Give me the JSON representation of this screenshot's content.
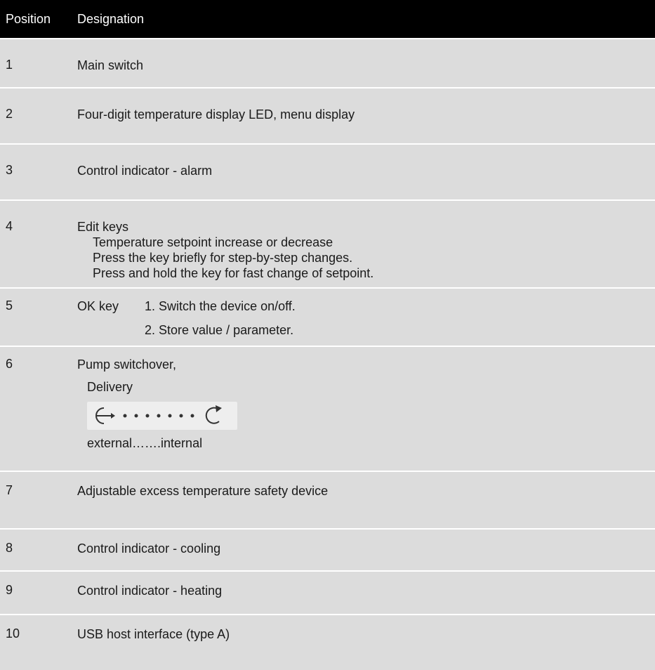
{
  "table": {
    "header": {
      "position": "Position",
      "designation": "Designation"
    },
    "rows": [
      {
        "position": "1",
        "designation": "Main switch"
      },
      {
        "position": "2",
        "designation": "Four-digit temperature display LED, menu display"
      },
      {
        "position": "3",
        "designation": "Control indicator - alarm"
      },
      {
        "position": "4",
        "designation": "Edit keys",
        "details": [
          "Temperature setpoint increase or decrease",
          "Press the key briefly for step-by-step changes.",
          "Press and hold the key for fast change of setpoint."
        ]
      },
      {
        "position": "5",
        "designation": "OK key",
        "steps": [
          "1. Switch the device on/off.",
          "2. Store value / parameter."
        ]
      },
      {
        "position": "6",
        "designation": "Pump switchover,",
        "sub_label": "Delivery",
        "symbol_icon": "pump-direction-symbol",
        "range_text": "external…….internal"
      },
      {
        "position": "7",
        "designation": "Adjustable excess temperature safety device"
      },
      {
        "position": "8",
        "designation": "Control indicator - cooling"
      },
      {
        "position": "9",
        "designation": "Control indicator - heating"
      },
      {
        "position": "10",
        "designation": "USB host interface (type A)"
      }
    ]
  },
  "colors": {
    "header_bg": "#000000",
    "row_bg": "#dcdcdc",
    "divider": "#ffffff"
  }
}
